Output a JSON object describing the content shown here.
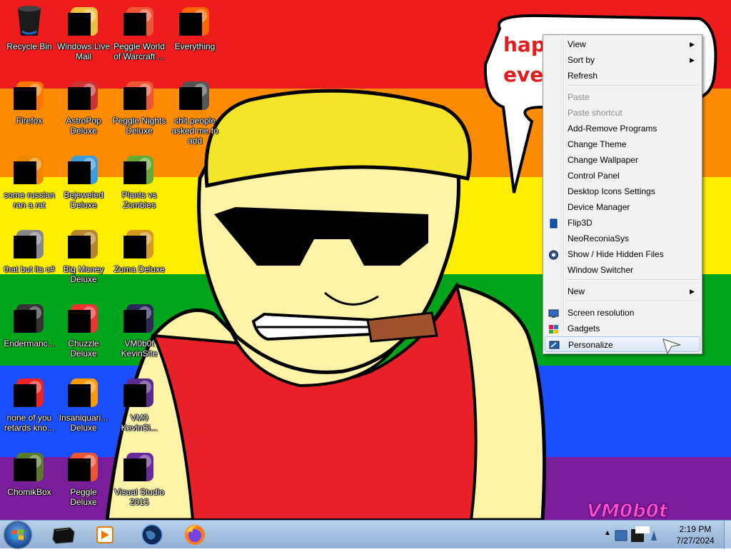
{
  "desktop_icons": [
    {
      "label": "Recycle Bin",
      "icon": "recycle-bin-icon"
    },
    {
      "label": "Windows Live Mail",
      "icon": "mail-icon"
    },
    {
      "label": "Peggle World of Warcraft ...",
      "icon": "peggle-icon"
    },
    {
      "label": "Everything",
      "icon": "search-everything-icon"
    },
    {
      "label": "Firefox",
      "icon": "firefox-icon"
    },
    {
      "label": "AstroPop Deluxe",
      "icon": "astropop-icon"
    },
    {
      "label": "Peggle Nights Deluxe",
      "icon": "peggle-nights-icon"
    },
    {
      "label": "shit people asked me to add",
      "icon": "folder-icon"
    },
    {
      "label": "some russian ran a rat",
      "icon": "app-icon"
    },
    {
      "label": "Bejeweled Deluxe",
      "icon": "bejeweled-icon"
    },
    {
      "label": "Plants vs Zombies",
      "icon": "plants-vs-zombies-icon"
    },
    {
      "label": "that but its c#",
      "icon": "app-icon"
    },
    {
      "label": "Big Money Deluxe",
      "icon": "money-bag-icon"
    },
    {
      "label": "Zuma Deluxe",
      "icon": "zuma-icon"
    },
    {
      "label": "Endermanc...",
      "icon": "window-app-icon"
    },
    {
      "label": "Chuzzle Deluxe",
      "icon": "chuzzle-icon"
    },
    {
      "label": "VM0b0t KevinSite",
      "icon": "site-icon"
    },
    {
      "label": "none of you retards kno...",
      "icon": "app-icon"
    },
    {
      "label": "Insaniquari... Deluxe",
      "icon": "insaniquarium-icon"
    },
    {
      "label": "VM0 KevinSi...",
      "icon": "site-icon"
    },
    {
      "label": "ChomikBox",
      "icon": "chomikbox-icon"
    },
    {
      "label": "Peggle Deluxe",
      "icon": "peggle-icon"
    },
    {
      "label": "Visual Studio 2015",
      "icon": "visual-studio-icon"
    }
  ],
  "speech_bubble": {
    "line1": "happ",
    "line2": "ever"
  },
  "watermark": "VM0b0t",
  "context_menu": {
    "items": [
      {
        "label": "View",
        "submenu": true,
        "disabled": false
      },
      {
        "label": "Sort by",
        "submenu": true,
        "disabled": false
      },
      {
        "label": "Refresh",
        "submenu": false,
        "disabled": false
      },
      {
        "label": "Paste",
        "submenu": false,
        "disabled": true
      },
      {
        "label": "Paste shortcut",
        "submenu": false,
        "disabled": true
      },
      {
        "label": "Add-Remove Programs",
        "submenu": false,
        "disabled": false
      },
      {
        "label": "Change Theme",
        "submenu": false,
        "disabled": false
      },
      {
        "label": "Change Wallpaper",
        "submenu": false,
        "disabled": false
      },
      {
        "label": "Control Panel",
        "submenu": false,
        "disabled": false
      },
      {
        "label": "Desktop Icons Settings",
        "submenu": false,
        "disabled": false
      },
      {
        "label": "Device Manager",
        "submenu": false,
        "disabled": false
      },
      {
        "label": "Flip3D",
        "submenu": false,
        "disabled": false,
        "icon": "flip3d-icon"
      },
      {
        "label": "NeoReconiaSys",
        "submenu": false,
        "disabled": false
      },
      {
        "label": "Show / Hide Hidden Files",
        "submenu": false,
        "disabled": false,
        "icon": "hidden-files-icon"
      },
      {
        "label": "Window Switcher",
        "submenu": false,
        "disabled": false
      },
      {
        "label": "New",
        "submenu": true,
        "disabled": false
      },
      {
        "label": "Screen resolution",
        "submenu": false,
        "disabled": false,
        "icon": "screen-resolution-icon"
      },
      {
        "label": "Gadgets",
        "submenu": false,
        "disabled": false,
        "icon": "gadgets-icon"
      },
      {
        "label": "Personalize",
        "submenu": false,
        "disabled": false,
        "icon": "personalize-icon",
        "highlighted": true
      }
    ]
  },
  "taskbar": {
    "pinned": [
      {
        "icon": "media-center-icon"
      },
      {
        "icon": "media-player-icon"
      },
      {
        "icon": "globe-icon"
      },
      {
        "icon": "firefox-icon"
      }
    ],
    "clock_time": "2:19 PM",
    "clock_date": "7/27/2024"
  },
  "colors": {
    "stripes": [
      "#ee1c1c",
      "#ff8c00",
      "#ffee00",
      "#00a51c",
      "#1a4fff",
      "#7a1d9a"
    ],
    "menu_bg": "#f1f1f1",
    "taskbar_top": "#b9d1ea"
  }
}
